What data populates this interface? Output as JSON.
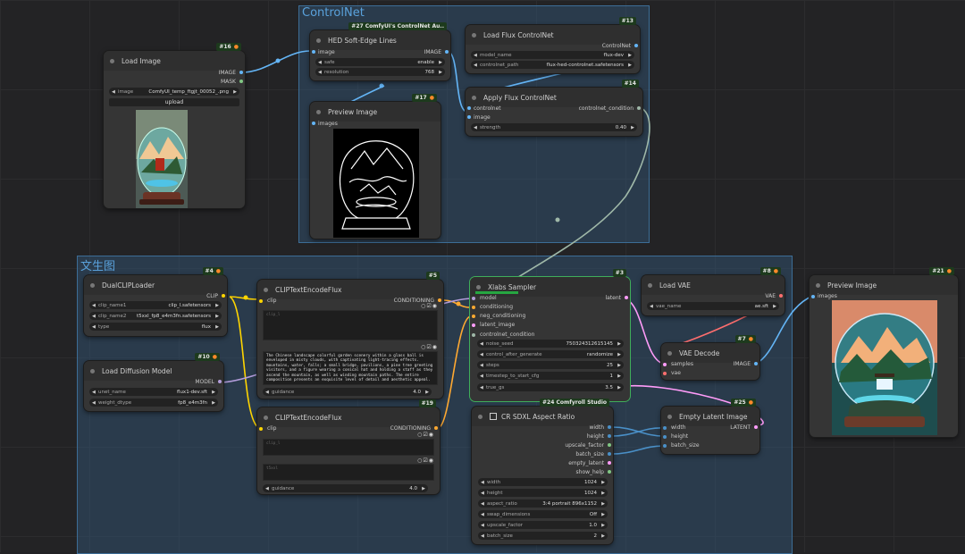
{
  "groups": {
    "controlnet": {
      "title": "ControlNet"
    },
    "wenshengtu": {
      "title": "文生图"
    }
  },
  "nodes": {
    "load_image": {
      "id": "#16",
      "title": "Load Image",
      "outputs": [
        "IMAGE",
        "MASK"
      ],
      "image_label": "image",
      "image_value": "ComfyUI_temp_ftgjt_00052_.png",
      "upload_label": "upload"
    },
    "hed": {
      "id": "#27 ComfyUI's ControlNet Au..",
      "title": "HED Soft-Edge Lines",
      "input": "image",
      "output": "IMAGE",
      "safe_label": "safe",
      "safe_value": "enable",
      "resolution_label": "resolution",
      "resolution_value": "768"
    },
    "preview1": {
      "id": "#17",
      "title": "Preview Image",
      "input": "images"
    },
    "load_cn": {
      "id": "#13",
      "title": "Load Flux ControlNet",
      "output": "ControlNet",
      "model_label": "model_name",
      "model_value": "flux-dev",
      "cn_label": "controlnet_path",
      "cn_value": "flux-hed-controlnet.safetensors"
    },
    "apply_cn": {
      "id": "#14",
      "title": "Apply Flux ControlNet",
      "inputs": [
        "controlnet",
        "image"
      ],
      "output": "controlnet_condition",
      "strength_label": "strength",
      "strength_value": "0.40"
    },
    "dualclip": {
      "id": "#4",
      "title": "DualCLIPLoader",
      "output": "CLIP",
      "clip1_label": "clip_name1",
      "clip1_value": "clip_l.safetensors",
      "clip2_label": "clip_name2",
      "clip2_value": "t5xxl_fp8_e4m3fn.safetensors",
      "type_label": "type",
      "type_value": "flux"
    },
    "load_diff": {
      "id": "#10",
      "title": "Load Diffusion Model",
      "output": "MODEL",
      "unet_label": "unet_name",
      "unet_value": "flux1-dev.sft",
      "dtype_label": "weight_dtype",
      "dtype_value": "fp8_e4m3fn"
    },
    "clip_enc1": {
      "id": "#5",
      "title": "CLIPTextEncodeFlux",
      "input": "clip",
      "output": "CONDITIONING",
      "clip_l_placeholder": "clip_l",
      "t5xxl_text": "The Chinese landscape colorful garden scenery within a glass ball is enveloped in misty clouds, with captivating light-tracing effects. mountains, water, falls; a small bridge, pavilions, a pine tree greeting visitors, and a figure wearing a conical hat and holding a staff as they ascend the mountain, as well as winding mountain paths. The entire composition presents an exquisite level of detail and aesthetic appeal.",
      "guidance_label": "guidance",
      "guidance_value": "4.0"
    },
    "clip_enc2": {
      "id": "#19",
      "title": "CLIPTextEncodeFlux",
      "input": "clip",
      "output": "CONDITIONING",
      "clip_l_placeholder": "clip_l",
      "t5xxl_placeholder": "t5xxl",
      "guidance_label": "guidance",
      "guidance_value": "4.0"
    },
    "xlabs": {
      "id": "#3",
      "title": "Xlabs Sampler",
      "inputs": [
        "model",
        "conditioning",
        "neg_conditioning",
        "latent_image",
        "controlnet_condition"
      ],
      "output": "latent",
      "widgets": [
        {
          "label": "noise_seed",
          "value": "750324312615145"
        },
        {
          "label": "control_after_generate",
          "value": "randomize"
        },
        {
          "label": "steps",
          "value": "25"
        },
        {
          "label": "timestep_to_start_cfg",
          "value": "1"
        },
        {
          "label": "true_gs",
          "value": "3.5"
        }
      ]
    },
    "load_vae": {
      "id": "#8",
      "title": "Load VAE",
      "output": "VAE",
      "vae_label": "vae_name",
      "vae_value": "ae.sft"
    },
    "vae_decode": {
      "id": "#7",
      "title": "VAE Decode",
      "inputs": [
        "samples",
        "vae"
      ],
      "output": "IMAGE"
    },
    "aspect": {
      "id": "#24 Comfyroll Studio",
      "title": "CR SDXL Aspect Ratio",
      "outputs": [
        "width",
        "height",
        "upscale_factor",
        "batch_size",
        "empty_latent",
        "show_help"
      ],
      "widgets": [
        {
          "label": "width",
          "value": "1024"
        },
        {
          "label": "height",
          "value": "1024"
        },
        {
          "label": "aspect_ratio",
          "value": "3:4 portrait 896x1152"
        },
        {
          "label": "swap_dimensions",
          "value": "Off"
        },
        {
          "label": "upscale_factor",
          "value": "1.0"
        },
        {
          "label": "batch_size",
          "value": "2"
        }
      ]
    },
    "empty_latent": {
      "id": "#25",
      "title": "Empty Latent Image",
      "inputs": [
        "width",
        "height",
        "batch_size"
      ],
      "output": "LATENT"
    },
    "preview2": {
      "id": "#21",
      "title": "Preview Image",
      "input": "images"
    }
  },
  "colors": {
    "image_slot": "#64b5f6",
    "mask_slot": "#81c784",
    "clip_slot": "#ffd500",
    "conditioning_slot": "#ffa931",
    "model_slot": "#b39ddb",
    "vae_slot": "#ff6e6e",
    "latent_slot": "#ff9cf9",
    "int_slot": "#4a90c8",
    "group_fill": "#345c82",
    "selection": "#3fae5a",
    "badge_bg": "#1d3a1d"
  }
}
